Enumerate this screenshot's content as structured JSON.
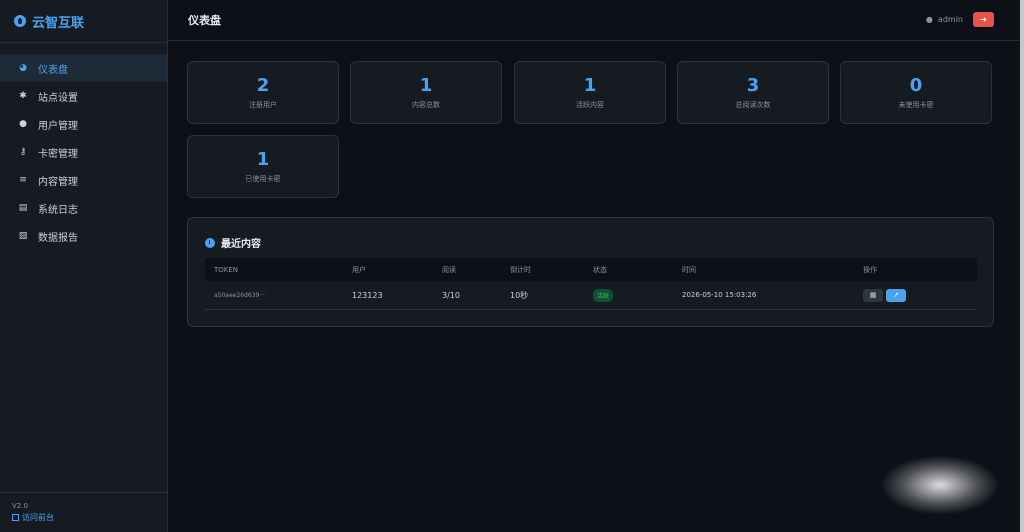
{
  "brand": {
    "title": "云智互联"
  },
  "sidebar": {
    "items": [
      {
        "label": "仪表盘",
        "icon": "dashboard-icon",
        "active": true
      },
      {
        "label": "站点设置",
        "icon": "gear-icon"
      },
      {
        "label": "用户管理",
        "icon": "users-icon"
      },
      {
        "label": "卡密管理",
        "icon": "key-icon"
      },
      {
        "label": "内容管理",
        "icon": "database-icon"
      },
      {
        "label": "系统日志",
        "icon": "clipboard-icon"
      },
      {
        "label": "数据报告",
        "icon": "file-icon"
      }
    ],
    "version": "V2.0",
    "front_link": "访问前台"
  },
  "header": {
    "title": "仪表盘",
    "username": "admin"
  },
  "stats": [
    {
      "value": "2",
      "label": "注册用户"
    },
    {
      "value": "1",
      "label": "内容总数"
    },
    {
      "value": "1",
      "label": "活跃内容"
    },
    {
      "value": "3",
      "label": "总阅读次数"
    },
    {
      "value": "0",
      "label": "未使用卡密"
    },
    {
      "value": "1",
      "label": "已使用卡密"
    }
  ],
  "recent": {
    "title": "最近内容",
    "columns": [
      "TOKEN",
      "用户",
      "阅读",
      "倒计时",
      "状态",
      "时间",
      "操作"
    ],
    "rows": [
      {
        "token": "a50aee26d639···",
        "user": "123123",
        "reads": "3/10",
        "countdown": "10秒",
        "status": "活跃",
        "time": "2026-05-10 15:03:26"
      }
    ]
  },
  "colors": {
    "accent": "#4aa3f0",
    "danger": "#e5534b",
    "success": "#3fb950",
    "bg": "#0d1117",
    "card": "#161b22"
  }
}
